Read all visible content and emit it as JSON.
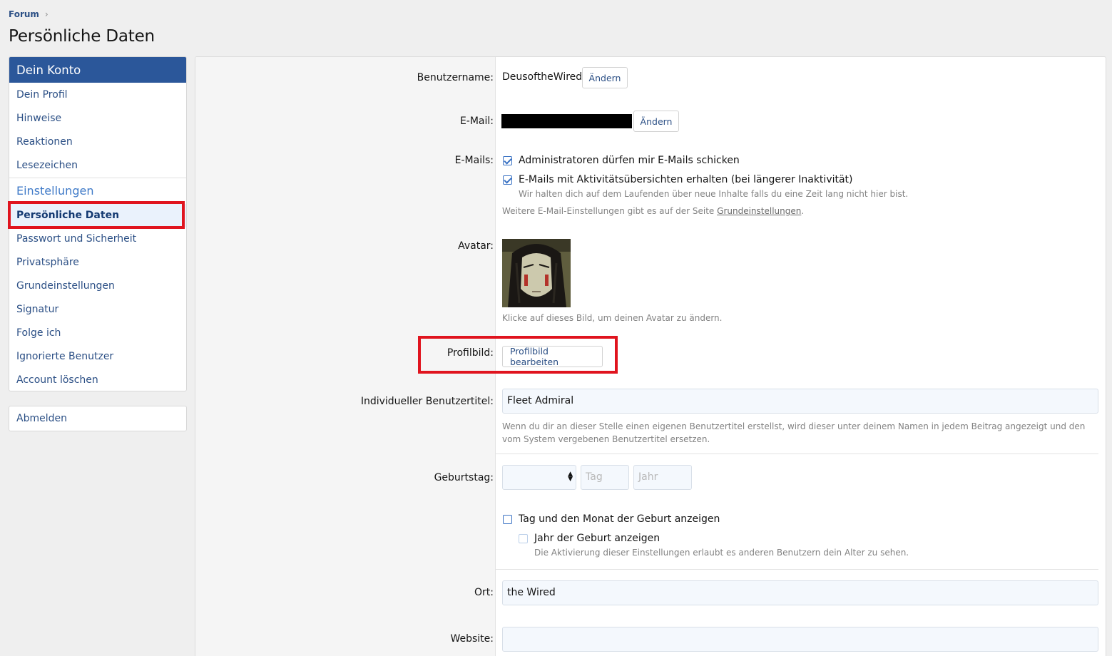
{
  "breadcrumb": {
    "item": "Forum"
  },
  "page_title": "Persönliche Daten",
  "sidebar": {
    "header": "Dein Konto",
    "items": [
      "Dein Profil",
      "Hinweise",
      "Reaktionen",
      "Lesezeichen"
    ],
    "section": "Einstellungen",
    "settings_items": [
      "Persönliche Daten",
      "Passwort und Sicherheit",
      "Privatsphäre",
      "Grundeinstellungen",
      "Signatur",
      "Folge ich",
      "Ignorierte Benutzer",
      "Account löschen"
    ],
    "logout": "Abmelden"
  },
  "form": {
    "username_label": "Benutzername:",
    "username_value": "DeusoftheWired",
    "change_label": "Ändern",
    "email_label": "E-Mail:",
    "emails_label": "E-Mails:",
    "emails_option1": "Administratoren dürfen mir E-Mails schicken",
    "emails_option2": "E-Mails mit Aktivitätsübersichten erhalten (bei längerer Inaktivität)",
    "emails_option2_hint": "Wir halten dich auf dem Laufenden über neue Inhalte falls du eine Zeit lang nicht hier bist.",
    "emails_more_prefix": "Weitere E-Mail-Einstellungen gibt es auf der Seite ",
    "emails_more_link": "Grundeinstellungen",
    "emails_more_suffix": ".",
    "avatar_label": "Avatar:",
    "avatar_hint": "Klicke auf dieses Bild, um deinen Avatar zu ändern.",
    "profilbild_label": "Profilbild:",
    "profilbild_button": "Profilbild bearbeiten",
    "title_label": "Individueller Benutzertitel:",
    "title_value": "Fleet Admiral",
    "title_hint": "Wenn du dir an dieser Stelle einen eigenen Benutzertitel erstellst, wird dieser unter deinem Namen in jedem Beitrag angezeigt und den vom System vergebenen Benutzertitel ersetzen.",
    "birthday_label": "Geburtstag:",
    "birthday_day_placeholder": "Tag",
    "birthday_year_placeholder": "Jahr",
    "birthday_option1": "Tag und den Monat der Geburt anzeigen",
    "birthday_option2": "Jahr der Geburt anzeigen",
    "birthday_hint": "Die Aktivierung dieser Einstellungen erlaubt es anderen Benutzern dein Alter zu sehen.",
    "location_label": "Ort:",
    "location_value": "the Wired",
    "website_label": "Website:"
  }
}
